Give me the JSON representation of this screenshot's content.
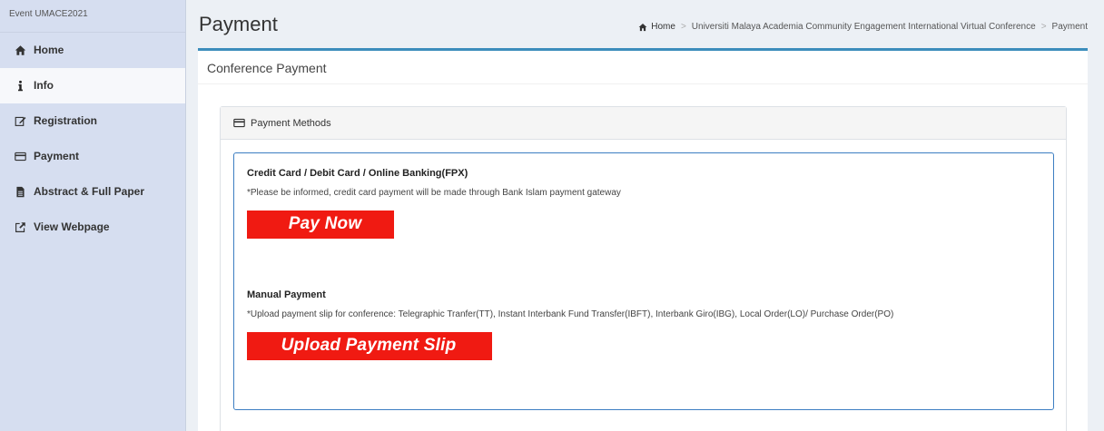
{
  "sidebar": {
    "header": "Event UMACE2021",
    "items": [
      {
        "label": "Home",
        "icon": "home-icon"
      },
      {
        "label": "Info",
        "icon": "info-icon"
      },
      {
        "label": "Registration",
        "icon": "edit-icon"
      },
      {
        "label": "Payment",
        "icon": "credit-card-icon"
      },
      {
        "label": "Abstract & Full Paper",
        "icon": "file-icon"
      },
      {
        "label": "View Webpage",
        "icon": "external-link-icon"
      }
    ],
    "active_index": 1
  },
  "header": {
    "title": "Payment",
    "breadcrumb": {
      "home": "Home",
      "conference": "Universiti Malaya Academia Community Engagement International Virtual Conference",
      "current": "Payment"
    }
  },
  "card": {
    "title": "Conference Payment",
    "panel_title": "Payment Methods",
    "online": {
      "title": "Credit Card / Debit Card / Online Banking(FPX)",
      "note": "*Please be informed, credit card payment will be made through Bank Islam payment gateway",
      "button": "Pay Now"
    },
    "manual": {
      "title": "Manual Payment",
      "note": "*Upload payment slip for conference: Telegraphic Tranfer(TT), Instant Interbank Fund Transfer(IBFT), Interbank Giro(IBG), Local Order(LO)/ Purchase Order(PO)",
      "button": "Upload Payment Slip"
    }
  },
  "colors": {
    "accent": "#3c8dbc",
    "button_red": "#f01a12",
    "sidebar_bg": "#d6def0"
  }
}
